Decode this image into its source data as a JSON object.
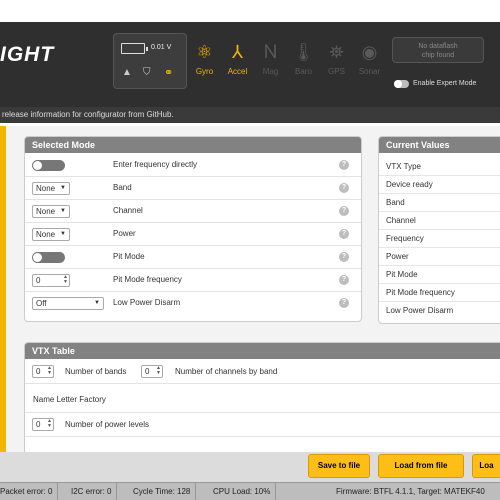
{
  "header": {
    "logo_text": "IGHT",
    "voltage": "0.01 V",
    "sensors": [
      {
        "name": "Gyro",
        "icon": "gyro-icon",
        "active": true
      },
      {
        "name": "Accel",
        "icon": "accel-icon",
        "active": true
      },
      {
        "name": "Mag",
        "icon": "mag-icon",
        "active": false
      },
      {
        "name": "Baro",
        "icon": "baro-icon",
        "active": false
      },
      {
        "name": "GPS",
        "icon": "gps-icon",
        "active": false
      },
      {
        "name": "Sonar",
        "icon": "sonar-icon",
        "active": false
      }
    ],
    "dataflash_line1": "No dataflash",
    "dataflash_line2": "chip found",
    "expert_mode_label": "Enable Expert Mode"
  },
  "infobar": {
    "text": "release information for configurator from GitHub."
  },
  "selected_mode": {
    "title": "Selected Mode",
    "rows": [
      {
        "label": "Enter frequency directly",
        "control": "toggle"
      },
      {
        "label": "Band",
        "control": "select",
        "value": "None"
      },
      {
        "label": "Channel",
        "control": "select",
        "value": "None"
      },
      {
        "label": "Power",
        "control": "select",
        "value": "None"
      },
      {
        "label": "Pit Mode",
        "control": "toggle"
      },
      {
        "label": "Pit Mode frequency",
        "control": "number",
        "value": "0"
      },
      {
        "label": "Low Power Disarm",
        "control": "select-wide",
        "value": "Off"
      }
    ],
    "help_glyph": "?"
  },
  "current_values": {
    "title": "Current Values",
    "rows": [
      "VTX Type",
      "Device ready",
      "Band",
      "Channel",
      "Frequency",
      "Power",
      "Pit Mode",
      "Pit Mode frequency",
      "Low Power Disarm"
    ]
  },
  "vtx_table": {
    "title": "VTX Table",
    "bands_value": "0",
    "bands_label": "Number of bands",
    "channels_value": "0",
    "channels_label": "Number of channels by band",
    "name_letter_factory": "Name Letter Factory",
    "power_levels_value": "0",
    "power_levels_label": "Number of power levels"
  },
  "toolbar": {
    "save_to_file": "Save to file",
    "load_from_file": "Load from file",
    "load_partial": "Loa"
  },
  "status": {
    "packet_error": "Packet error: 0",
    "i2c_error": "I2C error: 0",
    "cycle_time": "Cycle Time: 128",
    "cpu_load": "CPU Load: 10%",
    "firmware": "Firmware: BTFL 4.1.1, Target: MATEKF40"
  },
  "colors": {
    "accent": "#ffbe17",
    "header_bg": "#2f2f2f",
    "panel_head": "#828282"
  }
}
